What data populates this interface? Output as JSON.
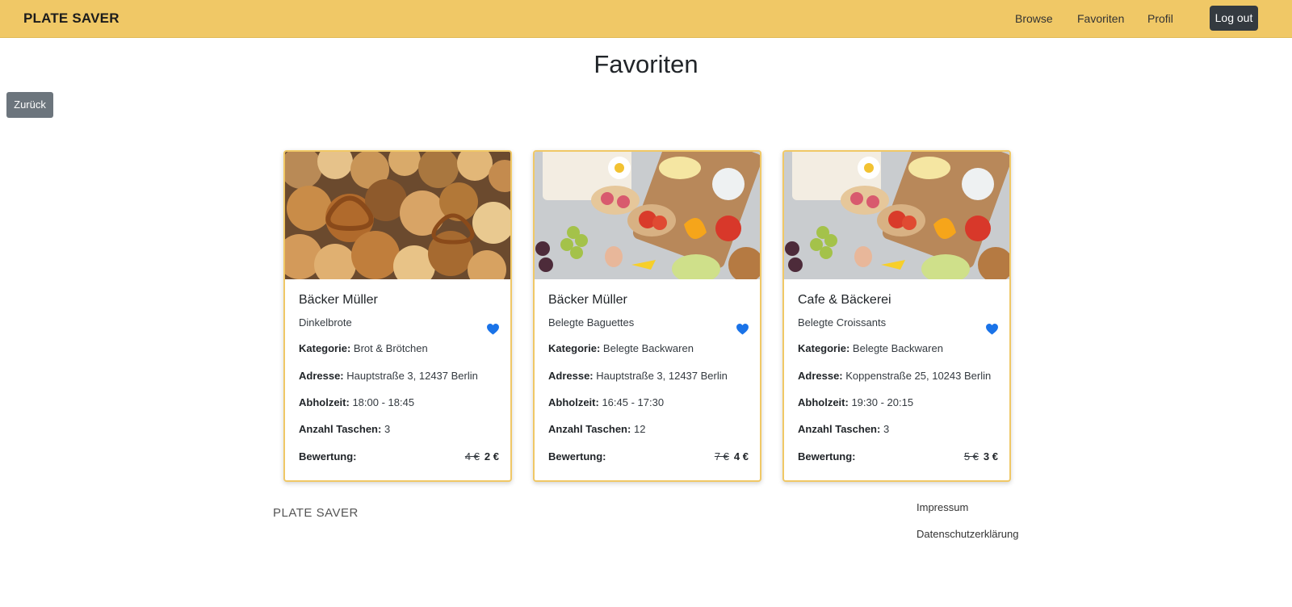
{
  "navbar": {
    "brand": "PLATE SAVER",
    "links": [
      "Browse",
      "Favoriten",
      "Profil"
    ],
    "logout_label": "Log out",
    "background_color": "#f0c866"
  },
  "page": {
    "title": "Favoriten",
    "back_label": "Zurück"
  },
  "labels": {
    "kategorie": "Kategorie:",
    "adresse": "Adresse:",
    "abholzeit": "Abholzeit:",
    "anzahl": "Anzahl Taschen:",
    "bewertung": "Bewertung:"
  },
  "cards": [
    {
      "image": "bread-rolls-pretzels-photo",
      "title": "Bäcker Müller",
      "subtitle": "Dinkelbrote",
      "kategorie": "Brot & Brötchen",
      "adresse": "Hauptstraße 3, 12437 Berlin",
      "abholzeit": "18:00 - 18:45",
      "anzahl": "3",
      "old_price": "4 €",
      "new_price": "2 €",
      "favorite": true
    },
    {
      "image": "open-sandwiches-board-photo",
      "title": "Bäcker Müller",
      "subtitle": "Belegte Baguettes",
      "kategorie": "Belegte Backwaren",
      "adresse": "Hauptstraße 3, 12437 Berlin",
      "abholzeit": "16:45 - 17:30",
      "anzahl": "12",
      "old_price": "7 €",
      "new_price": "4 €",
      "favorite": true
    },
    {
      "image": "open-sandwiches-board-photo",
      "title": "Cafe & Bäckerei",
      "subtitle": "Belegte Croissants",
      "kategorie": "Belegte Backwaren",
      "adresse": "Koppenstraße 25, 10243 Berlin",
      "abholzeit": "19:30 - 20:15",
      "anzahl": "3",
      "old_price": "5 €",
      "new_price": "3 €",
      "favorite": true
    }
  ],
  "footer": {
    "brand": "PLATE SAVER",
    "links": [
      "Impressum",
      "Datenschutzerklärung"
    ]
  },
  "colors": {
    "accent": "#f0c866",
    "heart": "#1a73e8",
    "dark_button": "#343a40",
    "secondary_button": "#6c757d"
  }
}
